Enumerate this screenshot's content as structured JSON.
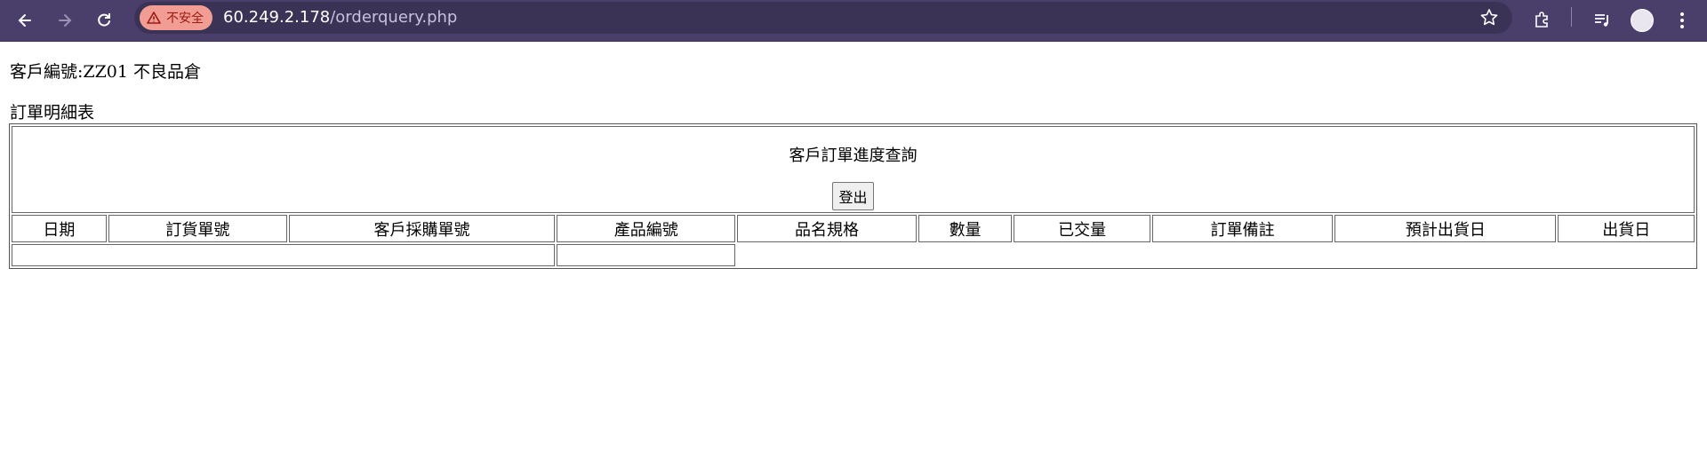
{
  "browser": {
    "security_label": "不安全",
    "url_host": "60.249.2.178",
    "url_path": "/orderquery.php",
    "accent": "#4a3f6b"
  },
  "page": {
    "customer_line": "客戶編號:ZZ01 不良品倉",
    "subtitle": "訂單明細表",
    "report_title": "客戶訂單進度查詢",
    "logout_label": "登出",
    "columns": [
      "日期",
      "訂貨單號",
      "客戶採購單號",
      "產品編號",
      "品名規格",
      "數量",
      "已交量",
      "訂單備註",
      "預計出貨日",
      "出貨日"
    ]
  }
}
